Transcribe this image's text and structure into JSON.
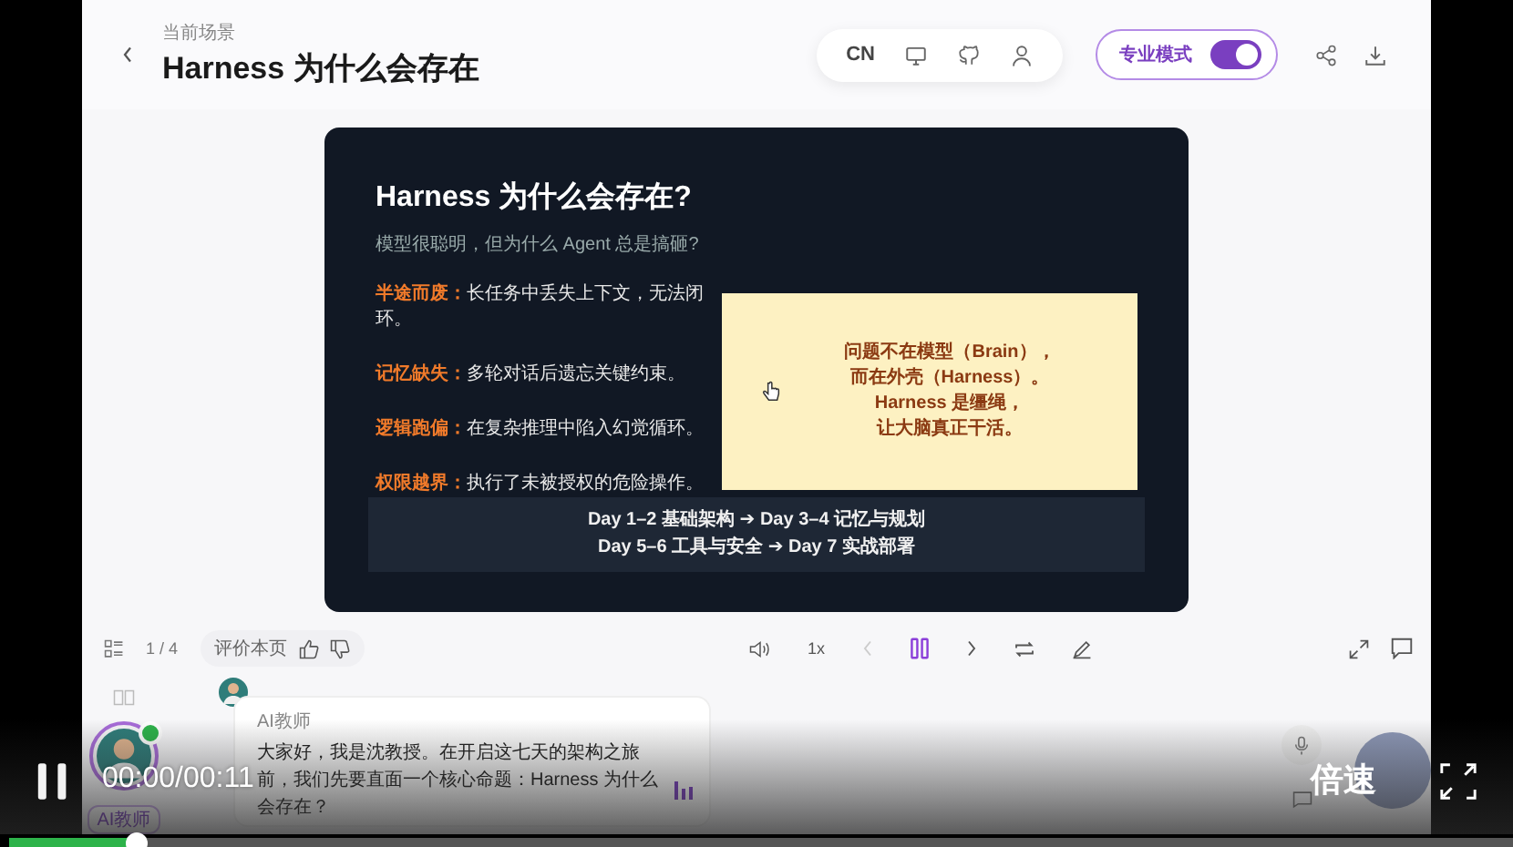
{
  "header": {
    "scene_label": "当前场景",
    "title": "Harness 为什么会存在",
    "language": "CN",
    "mode": {
      "label": "专业模式",
      "on": true
    }
  },
  "slide": {
    "title": "Harness 为什么会存在?",
    "subtitle": "模型很聪明，但为什么 Agent 总是搞砸?",
    "problems": [
      {
        "term": "半途而废：",
        "text": "长任务中丢失上下文，无法闭环。"
      },
      {
        "term": "记忆缺失：",
        "text": "多轮对话后遗忘关键约束。"
      },
      {
        "term": "逻辑跑偏：",
        "text": "在复杂推理中陷入幻觉循环。"
      },
      {
        "term": "权限越界：",
        "text": "执行了未被授权的危险操作。"
      }
    ],
    "callout": [
      "问题不在模型（Brain），",
      "而在外壳（Harness）。",
      "Harness 是缰绳，",
      "让大脑真正干活。"
    ],
    "roadmap": [
      "Day 1–2 基础架构 ➔ Day 3–4 记忆与规划",
      "Day 5–6 工具与安全 ➔ Day 7 实战部署"
    ]
  },
  "toolbar": {
    "page": "1 / 4",
    "rate_label": "评价本页",
    "speed": "1x",
    "playing": true
  },
  "chat": {
    "teacher_badge": "AI教师",
    "message": {
      "sender": "AI教师",
      "text": "大家好，我是沈教授。在开启这七天的架构之旅前，我们先要直面一个核心命题：Harness 为什么会存在？"
    }
  },
  "player": {
    "playing": true,
    "time": "00:00/00:11",
    "speed_label": "倍速",
    "level": 0.09
  }
}
